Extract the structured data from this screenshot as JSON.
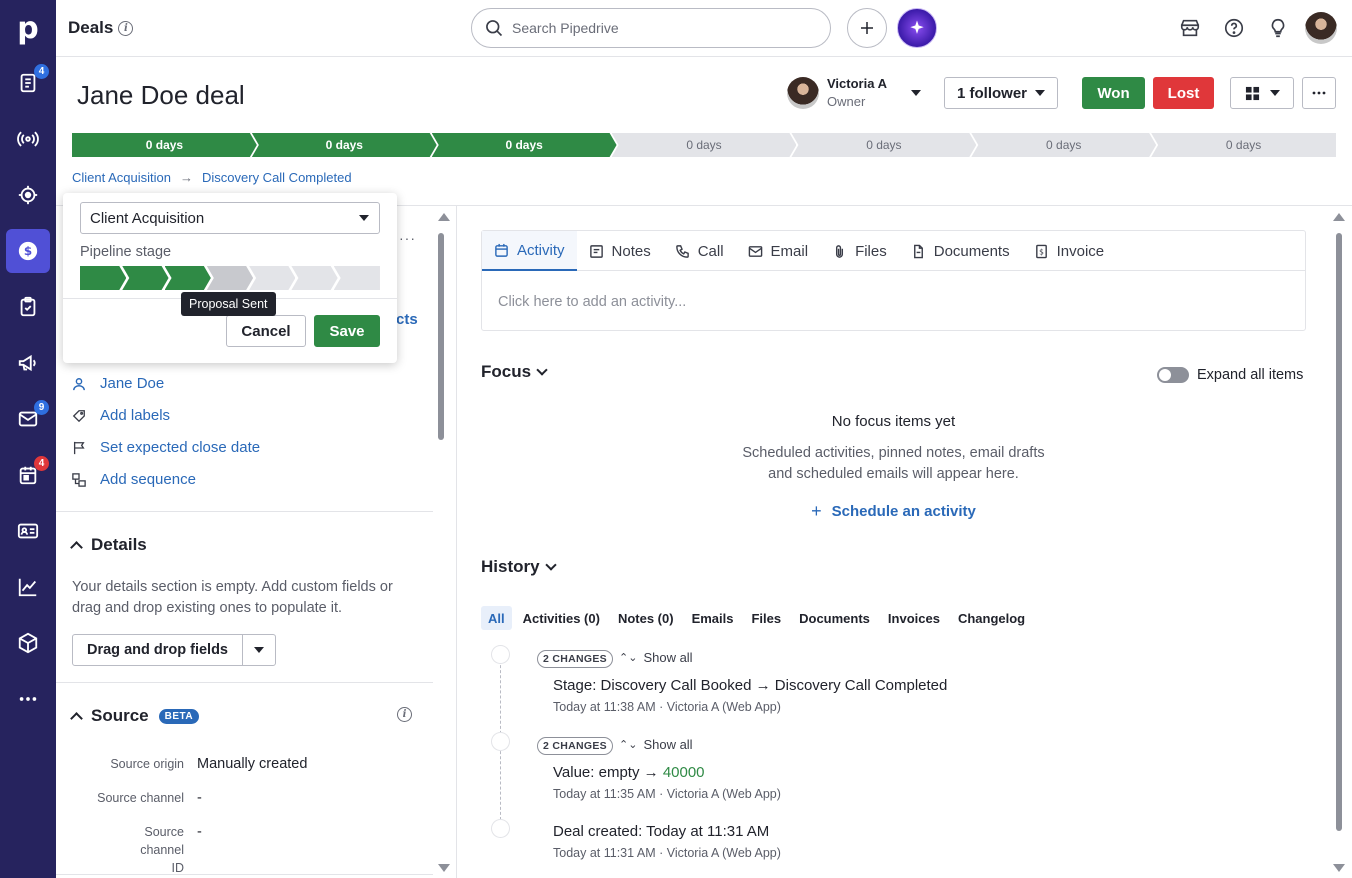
{
  "colors": {
    "nav_bg": "#26235e",
    "nav_active": "#5050d6",
    "green": "#2f8a45",
    "red": "#e0373a",
    "link": "#2a69b8"
  },
  "topbar": {
    "title": "Deals",
    "search_placeholder": "Search Pipedrive"
  },
  "nav": {
    "logo": "p",
    "badges": {
      "activities": "4",
      "mail": "9",
      "calendar": "4"
    }
  },
  "deal": {
    "title": "Jane Doe deal",
    "owner_name": "Victoria A",
    "owner_role": "Owner",
    "follower_label": "1 follower",
    "won_label": "Won",
    "lost_label": "Lost",
    "stages": [
      "0 days",
      "0 days",
      "0 days",
      "0 days",
      "0 days",
      "0 days",
      "0 days"
    ],
    "breadcrumb_pipeline": "Client Acquisition",
    "breadcrumb_stage": "Discovery Call Completed"
  },
  "popover": {
    "pipeline_value": "Client Acquisition",
    "stage_label": "Pipeline stage",
    "tooltip": "Proposal Sent",
    "cancel_label": "Cancel",
    "save_label": "Save",
    "peek_text": "cts"
  },
  "summary": {
    "person": "Jane Doe",
    "add_labels": "Add labels",
    "close_date": "Set expected close date",
    "sequence": "Add sequence"
  },
  "details": {
    "title": "Details",
    "empty_text": "Your details section is empty. Add custom fields or drag and drop existing ones to populate it.",
    "drag_label": "Drag and drop fields"
  },
  "source": {
    "title": "Source",
    "beta": "BETA",
    "rows": [
      {
        "label": "Source origin",
        "value": "Manually created"
      },
      {
        "label": "Source channel",
        "value": "-"
      },
      {
        "label": "Source channel ID",
        "value": "-"
      }
    ]
  },
  "tabs": {
    "activity": "Activity",
    "notes": "Notes",
    "call": "Call",
    "email": "Email",
    "files": "Files",
    "documents": "Documents",
    "invoice": "Invoice",
    "add_placeholder": "Click here to add an activity..."
  },
  "focus": {
    "title": "Focus",
    "expand_label": "Expand all items",
    "empty_title": "No focus items yet",
    "empty_line1": "Scheduled activities, pinned notes, email drafts",
    "empty_line2": "and scheduled emails will appear here.",
    "schedule_label": "Schedule an activity"
  },
  "history": {
    "title": "History",
    "tabs": [
      "All",
      "Activities (0)",
      "Notes (0)",
      "Emails",
      "Files",
      "Documents",
      "Invoices",
      "Changelog"
    ],
    "changes_badge": "2 CHANGES",
    "show_all": "Show all",
    "entries": [
      {
        "field": "Stage",
        "from": "Discovery Call Booked",
        "to": "Discovery Call Completed",
        "meta": "Today at 11:38 AM · Victoria A (Web App)"
      },
      {
        "field": "Value",
        "from": "empty",
        "to": "40000",
        "meta": "Today at 11:35 AM · Victoria A (Web App)"
      },
      {
        "field": "Deal created",
        "value": "Today at 11:31 AM",
        "meta": "Today at 11:31 AM · Victoria A (Web App)"
      }
    ]
  }
}
